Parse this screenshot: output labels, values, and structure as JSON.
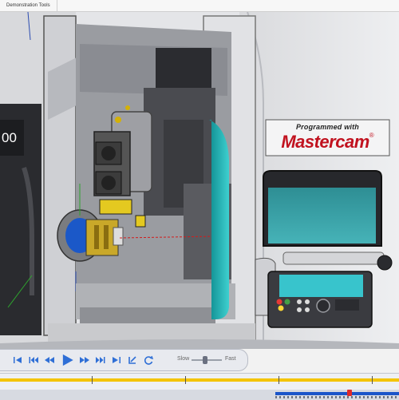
{
  "menubar": {
    "tab_label": "Demonstration Tools"
  },
  "machine": {
    "display_number": "00",
    "badge_top": "Programmed with",
    "badge_brand": "Mastercam",
    "badge_mark": "®"
  },
  "playback": {
    "buttons": [
      "skip-to-start",
      "step-back-large",
      "step-back",
      "rewind",
      "play",
      "fast-forward",
      "step-forward",
      "skip-to-end",
      "reset",
      "loop"
    ],
    "slow_label": "Slow",
    "fast_label": "Fast",
    "speed": 0.45
  },
  "timeline": {
    "progress": 0.876
  },
  "colors": {
    "accent_teal": "#1ca8a8",
    "timeline_yellow": "#f4c400",
    "timeline_blue": "#1b55c9",
    "marker_red": "#e02a2a",
    "brand_red": "#c1121f"
  }
}
